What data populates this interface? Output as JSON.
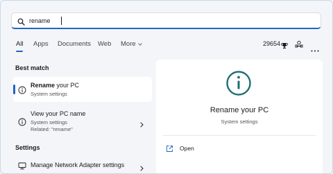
{
  "search": {
    "value": "rename"
  },
  "tabs": [
    {
      "label": "All"
    },
    {
      "label": "Apps"
    },
    {
      "label": "Documents"
    },
    {
      "label": "Web"
    },
    {
      "label": "More"
    }
  ],
  "header": {
    "points": "29654"
  },
  "best_match": {
    "heading": "Best match",
    "item": {
      "title_bold": "Rename",
      "title_rest": " your PC",
      "subtitle": "System settings"
    }
  },
  "result2": {
    "title": "View your PC name",
    "subtitle": "System settings",
    "related": "Related: \"rename\""
  },
  "settings": {
    "heading": "Settings",
    "item": {
      "title": "Manage Network Adapter settings"
    }
  },
  "preview": {
    "title": "Rename your PC",
    "subtitle": "System settings",
    "open_label": "Open"
  },
  "colors": {
    "accent": "#1f64c4",
    "icon_teal": "#1e6e73"
  }
}
